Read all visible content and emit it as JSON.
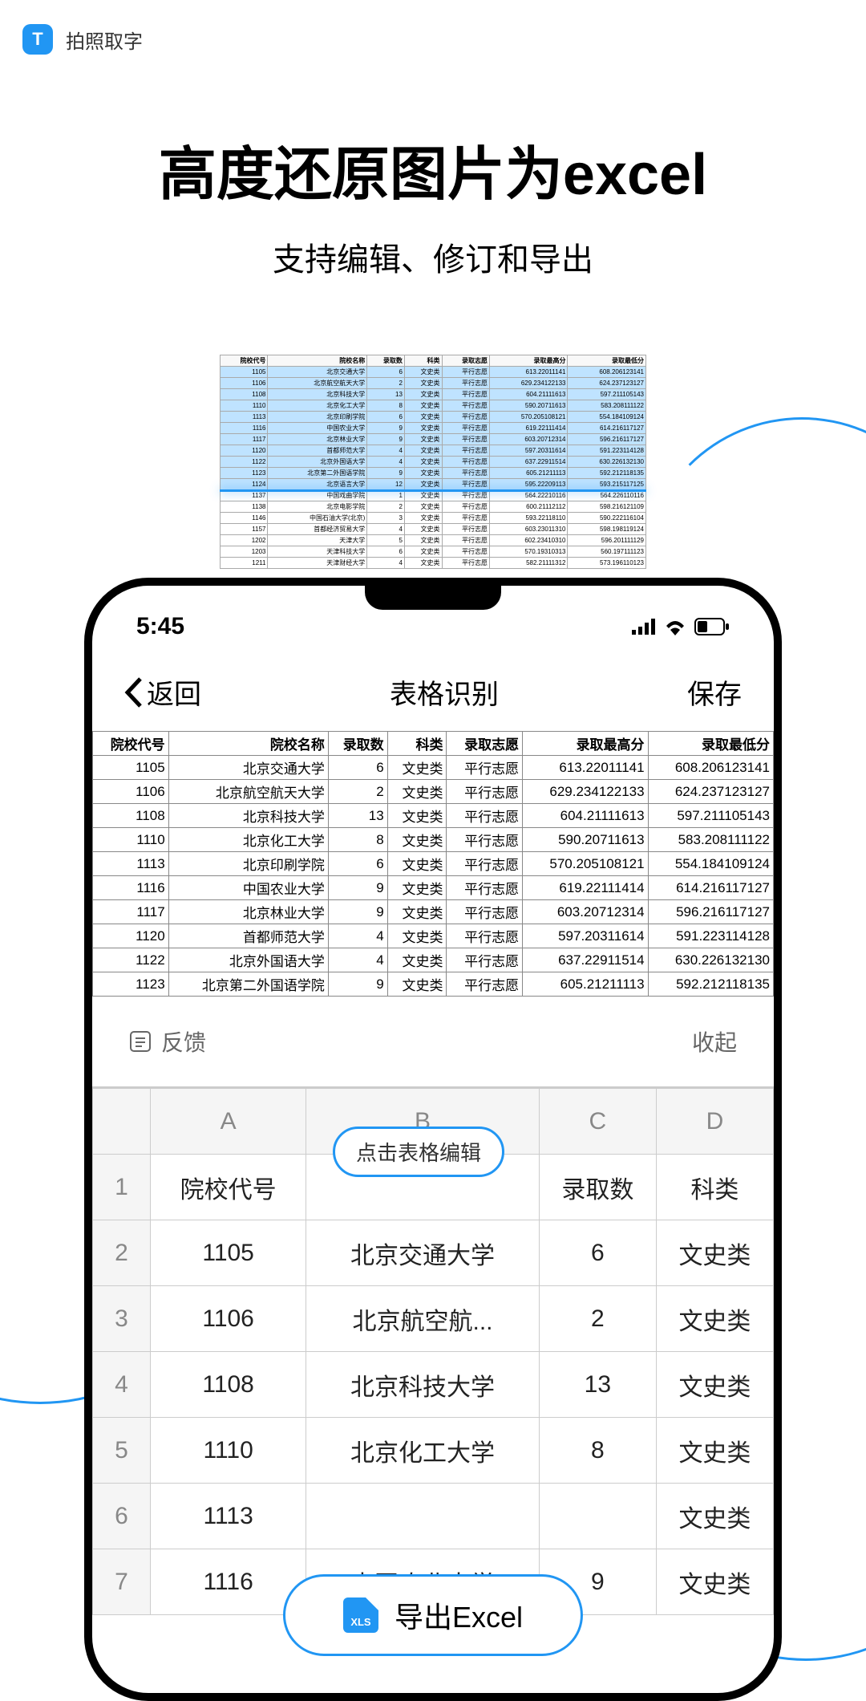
{
  "app": {
    "icon_text": "T",
    "name": "拍照取字"
  },
  "hero": {
    "title": "高度还原图片为excel",
    "subtitle": "支持编辑、修订和导出"
  },
  "status": {
    "time": "5:45"
  },
  "phone_nav": {
    "back": "返回",
    "title": "表格识别",
    "save": "保存"
  },
  "result_headers": [
    "院校代号",
    "院校名称",
    "录取数",
    "科类",
    "录取志愿",
    "录取最高分",
    "录取最低分"
  ],
  "result_rows": [
    [
      "1105",
      "北京交通大学",
      "6",
      "文史类",
      "平行志愿",
      "613.22011141",
      "608.206123141"
    ],
    [
      "1106",
      "北京航空航天大学",
      "2",
      "文史类",
      "平行志愿",
      "629.234122133",
      "624.237123127"
    ],
    [
      "1108",
      "北京科技大学",
      "13",
      "文史类",
      "平行志愿",
      "604.21111613",
      "597.211105143"
    ],
    [
      "1110",
      "北京化工大学",
      "8",
      "文史类",
      "平行志愿",
      "590.20711613",
      "583.208111122"
    ],
    [
      "1113",
      "北京印刷学院",
      "6",
      "文史类",
      "平行志愿",
      "570.205108121",
      "554.184109124"
    ],
    [
      "1116",
      "中国农业大学",
      "9",
      "文史类",
      "平行志愿",
      "619.22111414",
      "614.216117127"
    ],
    [
      "1117",
      "北京林业大学",
      "9",
      "文史类",
      "平行志愿",
      "603.20712314",
      "596.216117127"
    ],
    [
      "1120",
      "首都师范大学",
      "4",
      "文史类",
      "平行志愿",
      "597.20311614",
      "591.223114128"
    ],
    [
      "1122",
      "北京外国语大学",
      "4",
      "文史类",
      "平行志愿",
      "637.22911514",
      "630.226132130"
    ],
    [
      "1123",
      "北京第二外国语学院",
      "9",
      "文史类",
      "平行志愿",
      "605.21211113",
      "592.212118135"
    ]
  ],
  "scan_extra_rows": [
    [
      "1124",
      "北京语言大学",
      "12",
      "文史类",
      "平行志愿",
      "595.22209113",
      "593.215117125"
    ],
    [
      "1137",
      "中国戏曲学院",
      "1",
      "文史类",
      "平行志愿",
      "564.22210116",
      "564.226110116"
    ],
    [
      "1138",
      "北京电影学院",
      "2",
      "文史类",
      "平行志愿",
      "600.21112112",
      "598.216121109"
    ],
    [
      "1146",
      "中国石油大学(北京)",
      "3",
      "文史类",
      "平行志愿",
      "593.22118110",
      "590.222116104"
    ],
    [
      "1157",
      "首都经济贸易大学",
      "4",
      "文史类",
      "平行志愿",
      "603.23011310",
      "598.198119124"
    ],
    [
      "1202",
      "天津大学",
      "5",
      "文史类",
      "平行志愿",
      "602.23410310",
      "596.201111129"
    ],
    [
      "1203",
      "天津科技大学",
      "6",
      "文史类",
      "平行志愿",
      "570.19310313",
      "560.197111123"
    ],
    [
      "1211",
      "天津财经大学",
      "4",
      "文史类",
      "平行志愿",
      "582.21111312",
      "573.196110123"
    ]
  ],
  "feedback": {
    "label": "反馈",
    "collapse": "收起"
  },
  "sheet": {
    "cols": [
      "A",
      "B",
      "C",
      "D"
    ],
    "header_row": [
      "院校代号",
      "",
      "录取数",
      "科类"
    ],
    "tip": "点击表格编辑",
    "rows": [
      [
        "1105",
        "北京交通大学",
        "6",
        "文史类"
      ],
      [
        "1106",
        "北京航空航...",
        "2",
        "文史类"
      ],
      [
        "1108",
        "北京科技大学",
        "13",
        "文史类"
      ],
      [
        "1110",
        "北京化工大学",
        "8",
        "文史类"
      ],
      [
        "1113",
        "",
        "",
        "文史类"
      ],
      [
        "1116",
        "中国农业大学",
        "9",
        "文史类"
      ]
    ]
  },
  "export_label": "导出Excel",
  "xls_badge": "XLS"
}
